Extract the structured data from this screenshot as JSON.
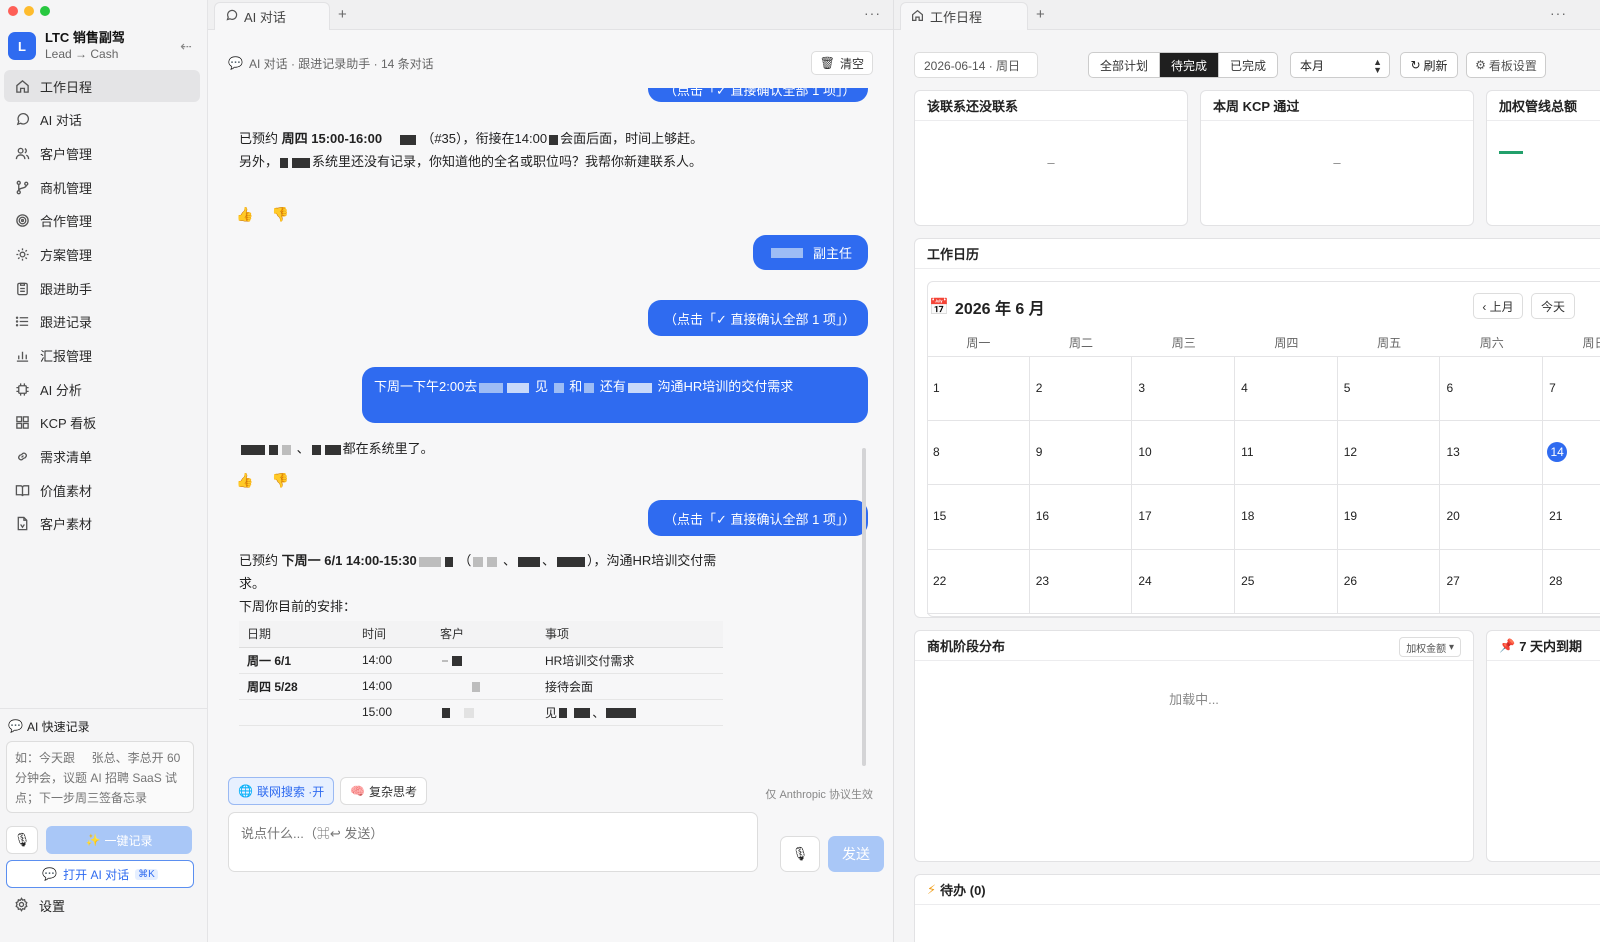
{
  "sidebar": {
    "app_title": "LTC 销售副驾",
    "app_subtitle": "Lead → Cash",
    "logo_letter": "L",
    "nav": [
      {
        "label": "工作日程",
        "icon": "home-icon",
        "active": true
      },
      {
        "label": "AI 对话",
        "icon": "chat-bubble-icon"
      },
      {
        "label": "客户管理",
        "icon": "users-icon"
      },
      {
        "label": "商机管理",
        "icon": "branch-icon"
      },
      {
        "label": "合作管理",
        "icon": "target-icon"
      },
      {
        "label": "方案管理",
        "icon": "sun-icon"
      },
      {
        "label": "跟进助手",
        "icon": "clipboard-icon"
      },
      {
        "label": "跟进记录",
        "icon": "list-icon"
      },
      {
        "label": "汇报管理",
        "icon": "bar-chart-icon"
      },
      {
        "label": "AI 分析",
        "icon": "chip-icon"
      },
      {
        "label": "KCP 看板",
        "icon": "grid-icon"
      },
      {
        "label": "需求清单",
        "icon": "link-icon"
      },
      {
        "label": "价值素材",
        "icon": "book-icon"
      },
      {
        "label": "客户素材",
        "icon": "document-icon"
      }
    ],
    "quick_title": "AI 快速记录",
    "quick_placeholder": "如：今天跟     张总、李总开 60 分钟会，议题 AI 招聘 SaaS 试点；下一步周三签备忘录",
    "one_click_label": "一键记录",
    "open_ai_label": "打开 AI 对话",
    "open_ai_kbd": "⌘K",
    "settings_label": "设置"
  },
  "chat": {
    "tab_label": "AI 对话",
    "header": "AI 对话 · 跟进记录助手  · 14 条对话",
    "clear_label": "清空",
    "confirm_bubble": "（点击「✓ 直接确认全部 1 项」）",
    "msg1_a": "已预约 ",
    "msg1_b": "周四 15:00-16:00",
    "msg1_c": "（#35），衔接在14:00",
    "msg1_d": "会面后面，时间上够赶。",
    "msg1_e": "另外，",
    "msg1_f": "系统里还没有记录，你知道他的全名或职位吗？我帮你新建联系人。",
    "user_bubble_1": "副主任",
    "user_bubble_2_a": "下周一下午2:00去",
    "user_bubble_2_b": "见",
    "user_bubble_2_c": "和",
    "user_bubble_2_d": "还有",
    "user_bubble_2_e": "沟通HR培训的交付需求",
    "msg2": "都在系统里了。",
    "msg3_a": "已预约 ",
    "msg3_b": "下周一 6/1 14:00-15:30",
    "msg3_c": "），沟通HR培训交付需求。",
    "msg3_d": "下周你目前的安排：",
    "table_headers": [
      "日期",
      "时间",
      "客户",
      "事项"
    ],
    "table_rows": [
      [
        "周一 6/1",
        "14:00",
        "",
        "HR培训交付需求"
      ],
      [
        "周四 5/28",
        "14:00",
        "",
        "接待会面"
      ],
      [
        "",
        "15:00",
        "",
        "见"
      ]
    ],
    "chip_search": "联网搜索 ·开",
    "chip_think": "复杂思考",
    "proto_note": "仅 Anthropic 协议生效",
    "input_placeholder": "说点什么...（⌘↩ 发送）",
    "send_label": "发送"
  },
  "dashboard": {
    "tab_label": "工作日程",
    "date_value": "2026-06-14 · 周日",
    "filters": [
      "全部计划",
      "待完成",
      "已完成"
    ],
    "active_filter": "待完成",
    "month_value": "本月",
    "refresh_label": "刷新",
    "board_settings_label": "看板设置",
    "card1_title": "该联系还没联系",
    "card1_value": "–",
    "card2_title": "本周 KCP 通过",
    "card2_value": "–",
    "card3_title": "加权管线总额",
    "calendar_section": "工作日历",
    "calendar_month": "2026 年 6 月",
    "prev_month": "‹ 上月",
    "today_btn": "今天",
    "weekdays": [
      "周一",
      "周二",
      "周三",
      "周四",
      "周五",
      "周六",
      "周日"
    ],
    "weeks": [
      [
        "1",
        "2",
        "3",
        "4",
        "5",
        "6",
        "7"
      ],
      [
        "8",
        "9",
        "10",
        "11",
        "12",
        "13",
        "14"
      ],
      [
        "15",
        "16",
        "17",
        "18",
        "19",
        "20",
        "21"
      ],
      [
        "22",
        "23",
        "24",
        "25",
        "26",
        "27",
        "28"
      ]
    ],
    "today_day": "14",
    "stage_title": "商机阶段分布",
    "weight_btn": "加权金额",
    "loading": "加载中...",
    "due_title": "7 天内到期",
    "todo_title": "待办 (0)"
  },
  "colors": {
    "accent": "#2f6bf0",
    "accent_light": "#a9c7f7",
    "active_seg": "#1f1f1f"
  }
}
